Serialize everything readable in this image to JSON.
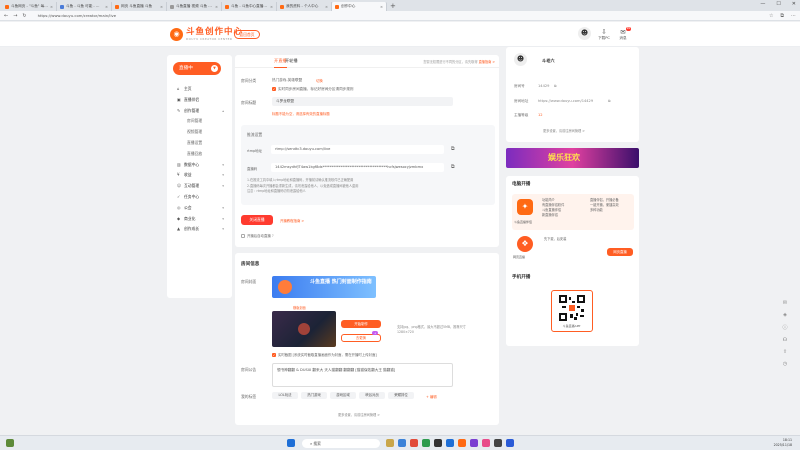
{
  "browser": {
    "tabs": [
      {
        "title": "斗鱼网页 - \"斗鱼\" 每 ... 斗鱼",
        "color": "#ff6a13"
      },
      {
        "title": "斗鱼 - 斗鱼 可能 - 斗鱼",
        "color": "#4a7bd8"
      },
      {
        "title": "网页 斗鱼直播 斗鱼",
        "color": "#ff6a13"
      },
      {
        "title": "斗鱼直播 视频 斗鱼 之旅",
        "color": "#999999"
      },
      {
        "title": "斗鱼 - 斗鱼中心直播平台",
        "color": "#ff6a13"
      },
      {
        "title": "我的资料 - 个人中心",
        "color": "#ff6a13"
      },
      {
        "title": "创作中心",
        "color": "#ff6a13"
      }
    ],
    "url": "https://www.douyu.com/creator/main/live"
  },
  "header": {
    "logo_title": "斗鱼创作中心",
    "logo_subtitle": "DOUYU CREATOR CENTER",
    "home_button": "返回首页",
    "download": "下载PC",
    "message": "消息",
    "message_badge": "99"
  },
  "sidebar": {
    "live_button": "直播中",
    "items": [
      {
        "label": "主页",
        "icon": "⌂",
        "sub": false
      },
      {
        "label": "直播伴侣",
        "icon": "▣",
        "sub": false
      },
      {
        "label": "创作管理",
        "icon": "✎",
        "sub": false,
        "chev": "▴"
      },
      {
        "label": "房间管理",
        "icon": "",
        "sub": true
      },
      {
        "label": "视频管理",
        "icon": "",
        "sub": true
      },
      {
        "label": "直播设置",
        "icon": "",
        "sub": true
      },
      {
        "label": "直播回放",
        "icon": "",
        "sub": true
      },
      {
        "label": "数据中心",
        "icon": "▥",
        "sub": false,
        "chev": "▾"
      },
      {
        "label": "收益",
        "icon": "¥",
        "sub": false,
        "chev": "▾"
      },
      {
        "label": "互动管理",
        "icon": "☺",
        "sub": false,
        "chev": "▾"
      },
      {
        "label": "任务中心",
        "icon": "✓",
        "sub": false
      },
      {
        "label": "公会",
        "icon": "◎",
        "sub": false,
        "chev": "▾"
      },
      {
        "label": "商业化",
        "icon": "◆",
        "sub": false,
        "chev": "▾"
      },
      {
        "label": "创作成长",
        "icon": "▲",
        "sub": false,
        "chev": "▾"
      }
    ]
  },
  "live": {
    "tab_live": "开直播",
    "tab_record": "开轮播",
    "tab_note": "您暂无权限进行不同的分区，请先取得",
    "tab_note_link": "直播指南 >",
    "category_label": "房间分类",
    "category_value": "热门游戏-英雄联盟",
    "category_link": "切换",
    "sync_text": "实时同步房间直播，标记好房间分区请同步规则",
    "title_label": "房间标题",
    "title_value": "斗罗龙联盟",
    "title_warn": "标题不能为空，请选择有效的直播标题",
    "stream_label": "推流设置",
    "rtmp_label": "rtmp地址",
    "rtmp_value": "rtmp://sendtc3.douyu.com/live",
    "key_label": "直播码",
    "key_value": "1442msydhfJT4aw1kgf8ds************************************hcfsjwesocyjzmbmx",
    "note1": "1.在推流工具中填入rtmp地址和直播码，开播前请确认推流软件已正确配置",
    "note2": "2.直播码每次开播都会重新生成，请勿泄露给他人，以免造成直播间被他人盗用",
    "note3": "注意：rtmp地址和直播码切勿泄露给他人",
    "start_button": "关闭直播",
    "tip_link": "开播教程指南 >",
    "auto_close": "开播后自动直播",
    "help": "?"
  },
  "room": {
    "section_title": "房间信息",
    "cover_label": "房间封面",
    "banner_text": "斗鱼直播 热门封面制作指南",
    "cover_tag": "横版封面",
    "upload_button": "开始制作",
    "change_button": "去更换",
    "change_badge": "+",
    "cover_note": "支持jpg、png格式，最大不超过5MB，推荐尺寸1280×720",
    "cover_check": "实时截图 [系统实时截取直播画面作为封面，需在开播时上传封面]",
    "notice_label": "房间公告",
    "notice_value": "想书神翻翻 & DUSIX 翻来大 天人猫翻翻 翻翻翻 [猫猫保佑翻大王 猫翻猫]",
    "tags_label": "我的标签",
    "tags": [
      "LOL玩法",
      "热门游戏",
      "游戏区域",
      "峡谷对战",
      "荣耀排位"
    ],
    "tags_edit": "+ 编辑",
    "more_link": "更多设置，请前往房间管理 >"
  },
  "profile": {
    "name": "斗老六",
    "room_label": "房间号",
    "room_value": "14429",
    "url_label": "房间地址",
    "url_value": "https://www.douyu.com/14429",
    "level_label": "主播等级",
    "level_value": "12",
    "more": "更多设置，请前往房间管理 >"
  },
  "promo": {
    "text": "娱乐狂欢"
  },
  "pc_live": {
    "title": "电脑开播",
    "app_name": "斗鱼直播伴侣",
    "desc": "功能简介\n有直播伴侣软件\n斗鱼直播伴侣\n新直播伴侣",
    "desc_right": "直播伴侣，开播必备\n一键开播，便捷高效\n多种功能",
    "download_label": "先下载，后安装",
    "download_app": "网页直播",
    "download_button": "网页直播"
  },
  "mobile_live": {
    "title": "手机开播",
    "qr_caption": "斗鱼直播APP"
  },
  "taskbar": {
    "search": "搜索",
    "time": "18:11",
    "date": "2025/11/18"
  },
  "colors": {
    "accent": "#ff5d23",
    "panel": "#ffffff",
    "bg": "#f0f1f3"
  }
}
